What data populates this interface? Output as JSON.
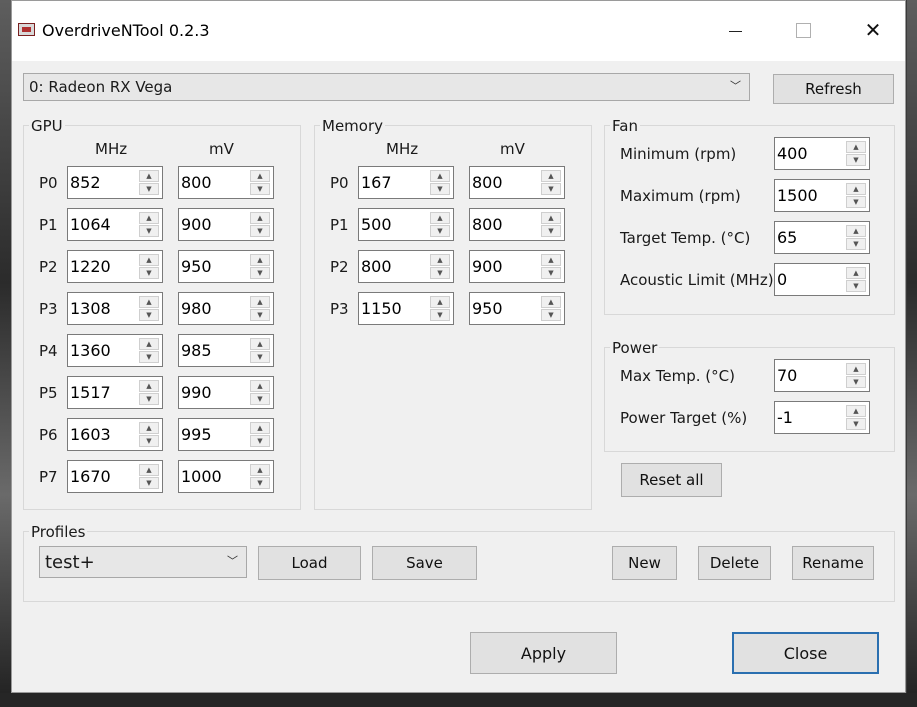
{
  "window": {
    "title": "OverdriveNTool 0.2.3"
  },
  "device": {
    "selected": "0: Radeon RX Vega",
    "refresh_label": "Refresh"
  },
  "gpu": {
    "title": "GPU",
    "mhz_header": "MHz",
    "mv_header": "mV",
    "states": [
      {
        "label": "P0",
        "mhz": "852",
        "mv": "800"
      },
      {
        "label": "P1",
        "mhz": "1064",
        "mv": "900"
      },
      {
        "label": "P2",
        "mhz": "1220",
        "mv": "950"
      },
      {
        "label": "P3",
        "mhz": "1308",
        "mv": "980"
      },
      {
        "label": "P4",
        "mhz": "1360",
        "mv": "985"
      },
      {
        "label": "P5",
        "mhz": "1517",
        "mv": "990"
      },
      {
        "label": "P6",
        "mhz": "1603",
        "mv": "995"
      },
      {
        "label": "P7",
        "mhz": "1670",
        "mv": "1000"
      }
    ]
  },
  "memory": {
    "title": "Memory",
    "mhz_header": "MHz",
    "mv_header": "mV",
    "states": [
      {
        "label": "P0",
        "mhz": "167",
        "mv": "800"
      },
      {
        "label": "P1",
        "mhz": "500",
        "mv": "800"
      },
      {
        "label": "P2",
        "mhz": "800",
        "mv": "900"
      },
      {
        "label": "P3",
        "mhz": "1150",
        "mv": "950"
      }
    ]
  },
  "fan": {
    "title": "Fan",
    "fields": [
      {
        "label": "Minimum (rpm)",
        "value": "400"
      },
      {
        "label": "Maximum (rpm)",
        "value": "1500"
      },
      {
        "label": "Target Temp. (°C)",
        "value": "65"
      },
      {
        "label": "Acoustic Limit (MHz)",
        "value": "0"
      }
    ]
  },
  "power": {
    "title": "Power",
    "fields": [
      {
        "label": "Max Temp. (°C)",
        "value": "70"
      },
      {
        "label": "Power Target (%)",
        "value": "-1"
      }
    ]
  },
  "reset_all_label": "Reset all",
  "profiles": {
    "title": "Profiles",
    "selected": "test+",
    "load_label": "Load",
    "save_label": "Save",
    "new_label": "New",
    "delete_label": "Delete",
    "rename_label": "Rename"
  },
  "footer": {
    "apply_label": "Apply",
    "close_label": "Close"
  }
}
